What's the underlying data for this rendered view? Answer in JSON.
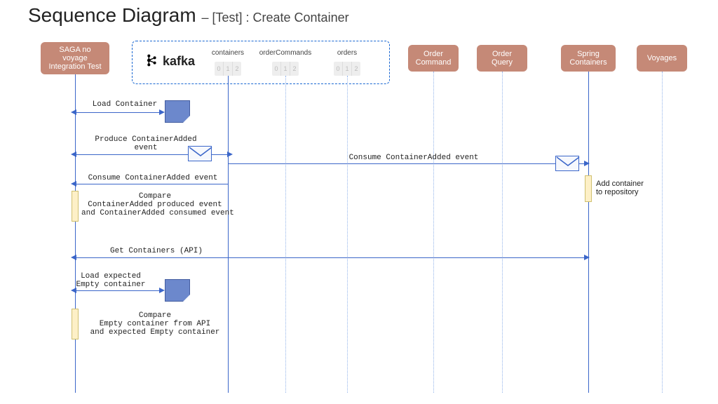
{
  "title": {
    "main": "Sequence Diagram",
    "sub": "– [Test] : Create Container"
  },
  "participants": {
    "saga": {
      "label": "SAGA no\nvoyage\nIntegration Test"
    },
    "kafka": {
      "label": "kafka",
      "topics": [
        "containers",
        "orderCommands",
        "orders"
      ]
    },
    "orderCommand": {
      "label": "Order\nCommand"
    },
    "orderQuery": {
      "label": "Order\nQuery"
    },
    "springContainers": {
      "label": "Spring\nContainers"
    },
    "voyages": {
      "label": "Voyages"
    }
  },
  "messages": {
    "loadContainer": {
      "label": "Load Container"
    },
    "produceEvent": {
      "label": "Produce ContainerAdded\nevent"
    },
    "consumeKafkaToSpring": {
      "label": "Consume ContainerAdded event"
    },
    "consumeKafkaToSaga": {
      "label": "Consume ContainerAdded event"
    },
    "compare1": {
      "label": "Compare\nContainerAdded produced event\nand ContainerAdded consumed event"
    },
    "addRepo": {
      "label": "Add container\nto repository"
    },
    "getContainers": {
      "label": "Get Containers (API)"
    },
    "loadExpected": {
      "label": "Load expected\nEmpty container"
    },
    "compare2": {
      "label": "Compare\nEmpty container from API\nand expected Empty container"
    }
  },
  "partitions": [
    "0",
    "1",
    "2"
  ]
}
